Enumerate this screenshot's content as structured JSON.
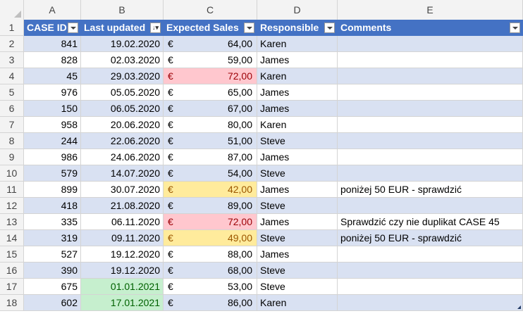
{
  "columns": [
    "A",
    "B",
    "C",
    "D",
    "E"
  ],
  "header_row": {
    "row_num": "1",
    "labels": [
      "CASE ID",
      "Last updated",
      "Expected Sales",
      "Responsible",
      "Comments"
    ]
  },
  "rows": [
    {
      "n": "2",
      "id": "841",
      "date": "19.02.2020",
      "cur": "€",
      "amt": "64,00",
      "resp": "Karen",
      "comment": "",
      "amt_fill": "",
      "date_fill": ""
    },
    {
      "n": "3",
      "id": "828",
      "date": "02.03.2020",
      "cur": "€",
      "amt": "59,00",
      "resp": "James",
      "comment": "",
      "amt_fill": "",
      "date_fill": ""
    },
    {
      "n": "4",
      "id": "45",
      "date": "29.03.2020",
      "cur": "€",
      "amt": "72,00",
      "resp": "Karen",
      "comment": "",
      "amt_fill": "red",
      "date_fill": ""
    },
    {
      "n": "5",
      "id": "976",
      "date": "05.05.2020",
      "cur": "€",
      "amt": "65,00",
      "resp": "James",
      "comment": "",
      "amt_fill": "",
      "date_fill": ""
    },
    {
      "n": "6",
      "id": "150",
      "date": "06.05.2020",
      "cur": "€",
      "amt": "67,00",
      "resp": "James",
      "comment": "",
      "amt_fill": "",
      "date_fill": ""
    },
    {
      "n": "7",
      "id": "958",
      "date": "20.06.2020",
      "cur": "€",
      "amt": "80,00",
      "resp": "Karen",
      "comment": "",
      "amt_fill": "",
      "date_fill": ""
    },
    {
      "n": "8",
      "id": "244",
      "date": "22.06.2020",
      "cur": "€",
      "amt": "51,00",
      "resp": "Steve",
      "comment": "",
      "amt_fill": "",
      "date_fill": ""
    },
    {
      "n": "9",
      "id": "986",
      "date": "24.06.2020",
      "cur": "€",
      "amt": "87,00",
      "resp": "James",
      "comment": "",
      "amt_fill": "",
      "date_fill": ""
    },
    {
      "n": "10",
      "id": "579",
      "date": "14.07.2020",
      "cur": "€",
      "amt": "54,00",
      "resp": "Steve",
      "comment": "",
      "amt_fill": "",
      "date_fill": ""
    },
    {
      "n": "11",
      "id": "899",
      "date": "30.07.2020",
      "cur": "€",
      "amt": "42,00",
      "resp": "James",
      "comment": "poniżej 50 EUR - sprawdzić",
      "amt_fill": "yellow",
      "date_fill": ""
    },
    {
      "n": "12",
      "id": "418",
      "date": "21.08.2020",
      "cur": "€",
      "amt": "89,00",
      "resp": "Steve",
      "comment": "",
      "amt_fill": "",
      "date_fill": ""
    },
    {
      "n": "13",
      "id": "335",
      "date": "06.11.2020",
      "cur": "€",
      "amt": "72,00",
      "resp": "James",
      "comment": "Sprawdzić czy nie duplikat CASE 45",
      "amt_fill": "red",
      "date_fill": ""
    },
    {
      "n": "14",
      "id": "319",
      "date": "09.11.2020",
      "cur": "€",
      "amt": "49,00",
      "resp": "Steve",
      "comment": "poniżej 50 EUR - sprawdzić",
      "amt_fill": "yellow",
      "date_fill": ""
    },
    {
      "n": "15",
      "id": "527",
      "date": "19.12.2020",
      "cur": "€",
      "amt": "88,00",
      "resp": "James",
      "comment": "",
      "amt_fill": "",
      "date_fill": ""
    },
    {
      "n": "16",
      "id": "390",
      "date": "19.12.2020",
      "cur": "€",
      "amt": "68,00",
      "resp": "Steve",
      "comment": "",
      "amt_fill": "",
      "date_fill": ""
    },
    {
      "n": "17",
      "id": "675",
      "date": "01.01.2021",
      "cur": "€",
      "amt": "53,00",
      "resp": "Steve",
      "comment": "",
      "amt_fill": "",
      "date_fill": "green"
    },
    {
      "n": "18",
      "id": "602",
      "date": "17.01.2021",
      "cur": "€",
      "amt": "86,00",
      "resp": "Karen",
      "comment": "",
      "amt_fill": "",
      "date_fill": "green"
    }
  ],
  "colors": {
    "table_header": "#4472c4",
    "band": "#d9e1f2",
    "red_fill": "#ffc7ce",
    "yellow_fill": "#ffeb9c",
    "green_fill": "#c6efce"
  },
  "icons": {
    "filter": "filter-dropdown-icon",
    "sort_filter": "sort-descending-filter-icon"
  }
}
